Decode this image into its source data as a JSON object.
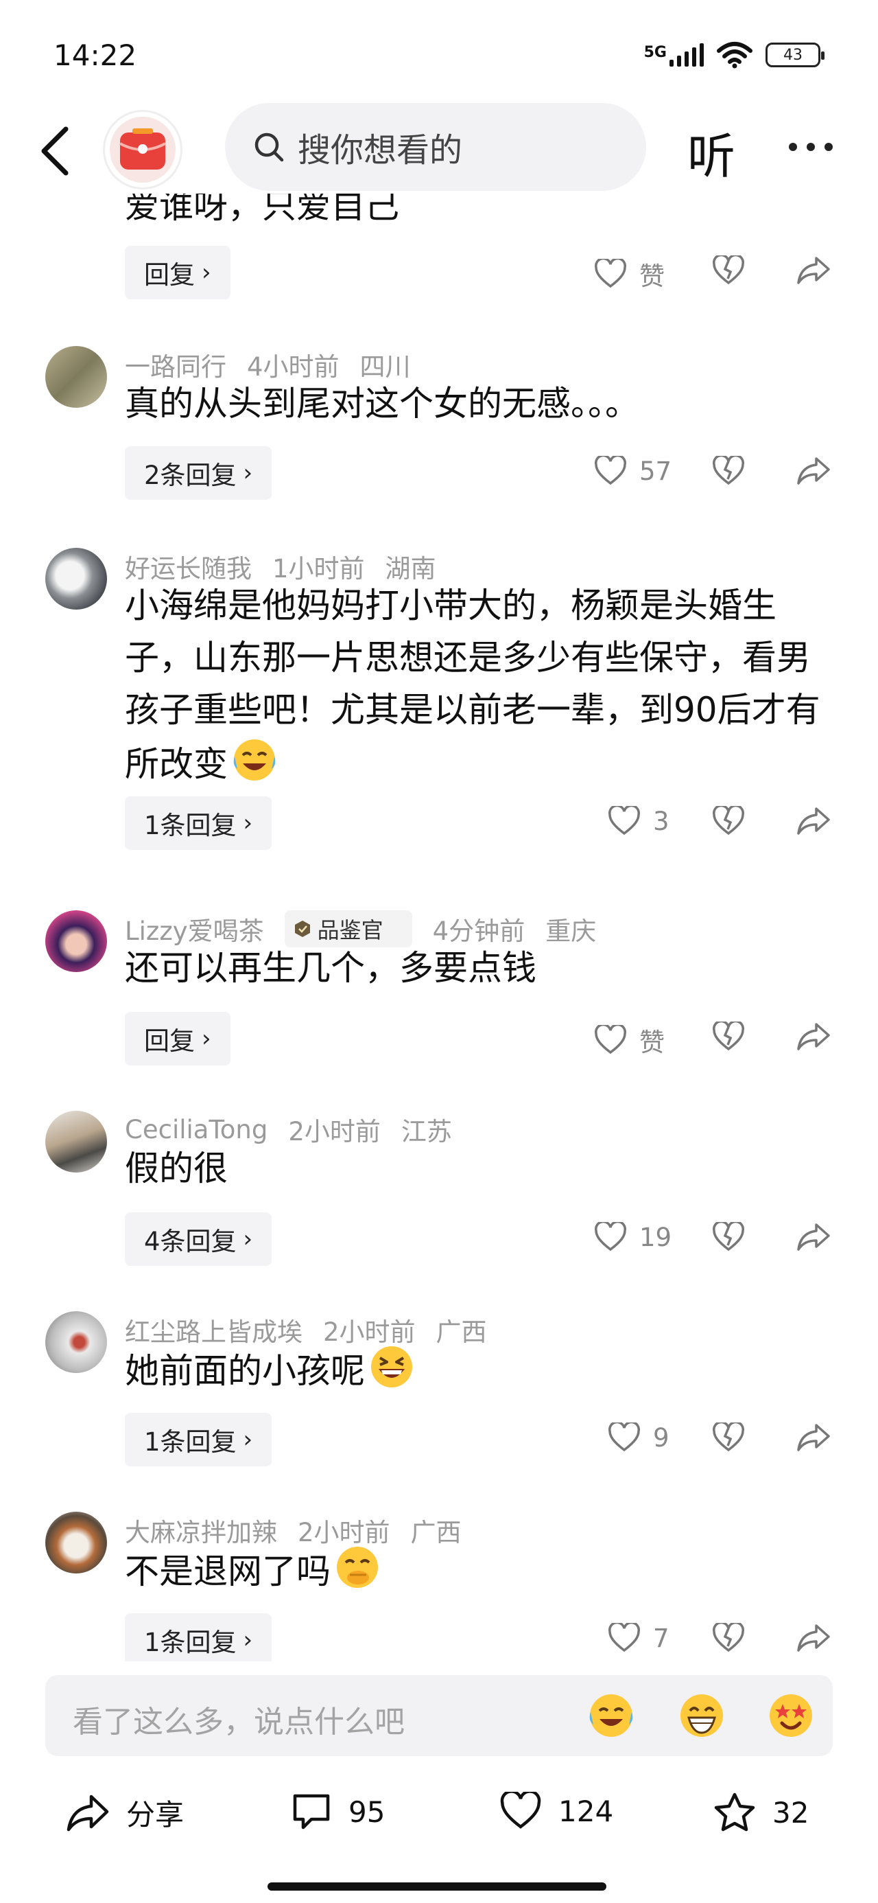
{
  "status": {
    "time": "14:22",
    "network": "5G",
    "battery": "43"
  },
  "nav": {
    "search_placeholder": "搜你想看的",
    "listen_label": "听"
  },
  "clipped_text": "爱谁呀，只爱自己",
  "first_actions": {
    "reply_label": "回复",
    "like_label": "赞"
  },
  "comments": [
    {
      "user": "一路同行",
      "time": "4小时前",
      "location": "四川",
      "text": "真的从头到尾对这个女的无感。。。",
      "reply_label": "2条回复",
      "likes": "57"
    },
    {
      "user": "好运长随我",
      "time": "1小时前",
      "location": "湖南",
      "text": "小海绵是他妈妈打小带大的，杨颖是头婚生子，山东那一片思想还是多少有些保守，看男孩子重些吧！尤其是以前老一辈，到90后才有所改变",
      "reply_label": "1条回复",
      "likes": "3"
    },
    {
      "user": "Lizzy爱喝茶",
      "badge": "品鉴官",
      "time": "4分钟前",
      "location": "重庆",
      "text": "还可以再生几个，多要点钱",
      "reply_label": "回复",
      "likes": "赞"
    },
    {
      "user": "CeciliaTong",
      "time": "2小时前",
      "location": "江苏",
      "text": "假的很",
      "reply_label": "4条回复",
      "likes": "19"
    },
    {
      "user": "红尘路上皆成埃",
      "time": "2小时前",
      "location": "广西",
      "text": "她前面的小孩呢",
      "reply_label": "1条回复",
      "likes": "9"
    },
    {
      "user": "大麻凉拌加辣",
      "time": "2小时前",
      "location": "广西",
      "text": "不是退网了吗",
      "reply_label": "1条回复",
      "likes": "7"
    }
  ],
  "input": {
    "placeholder": "看了这么多，说点什么吧"
  },
  "bottom": {
    "share_label": "分享",
    "comment_count": "95",
    "like_count": "124",
    "star_count": "32"
  },
  "icons": [
    "back-icon",
    "search-icon",
    "more-icon",
    "heart-icon",
    "broken-heart-icon",
    "share-arrow-icon",
    "comment-icon",
    "star-icon"
  ]
}
